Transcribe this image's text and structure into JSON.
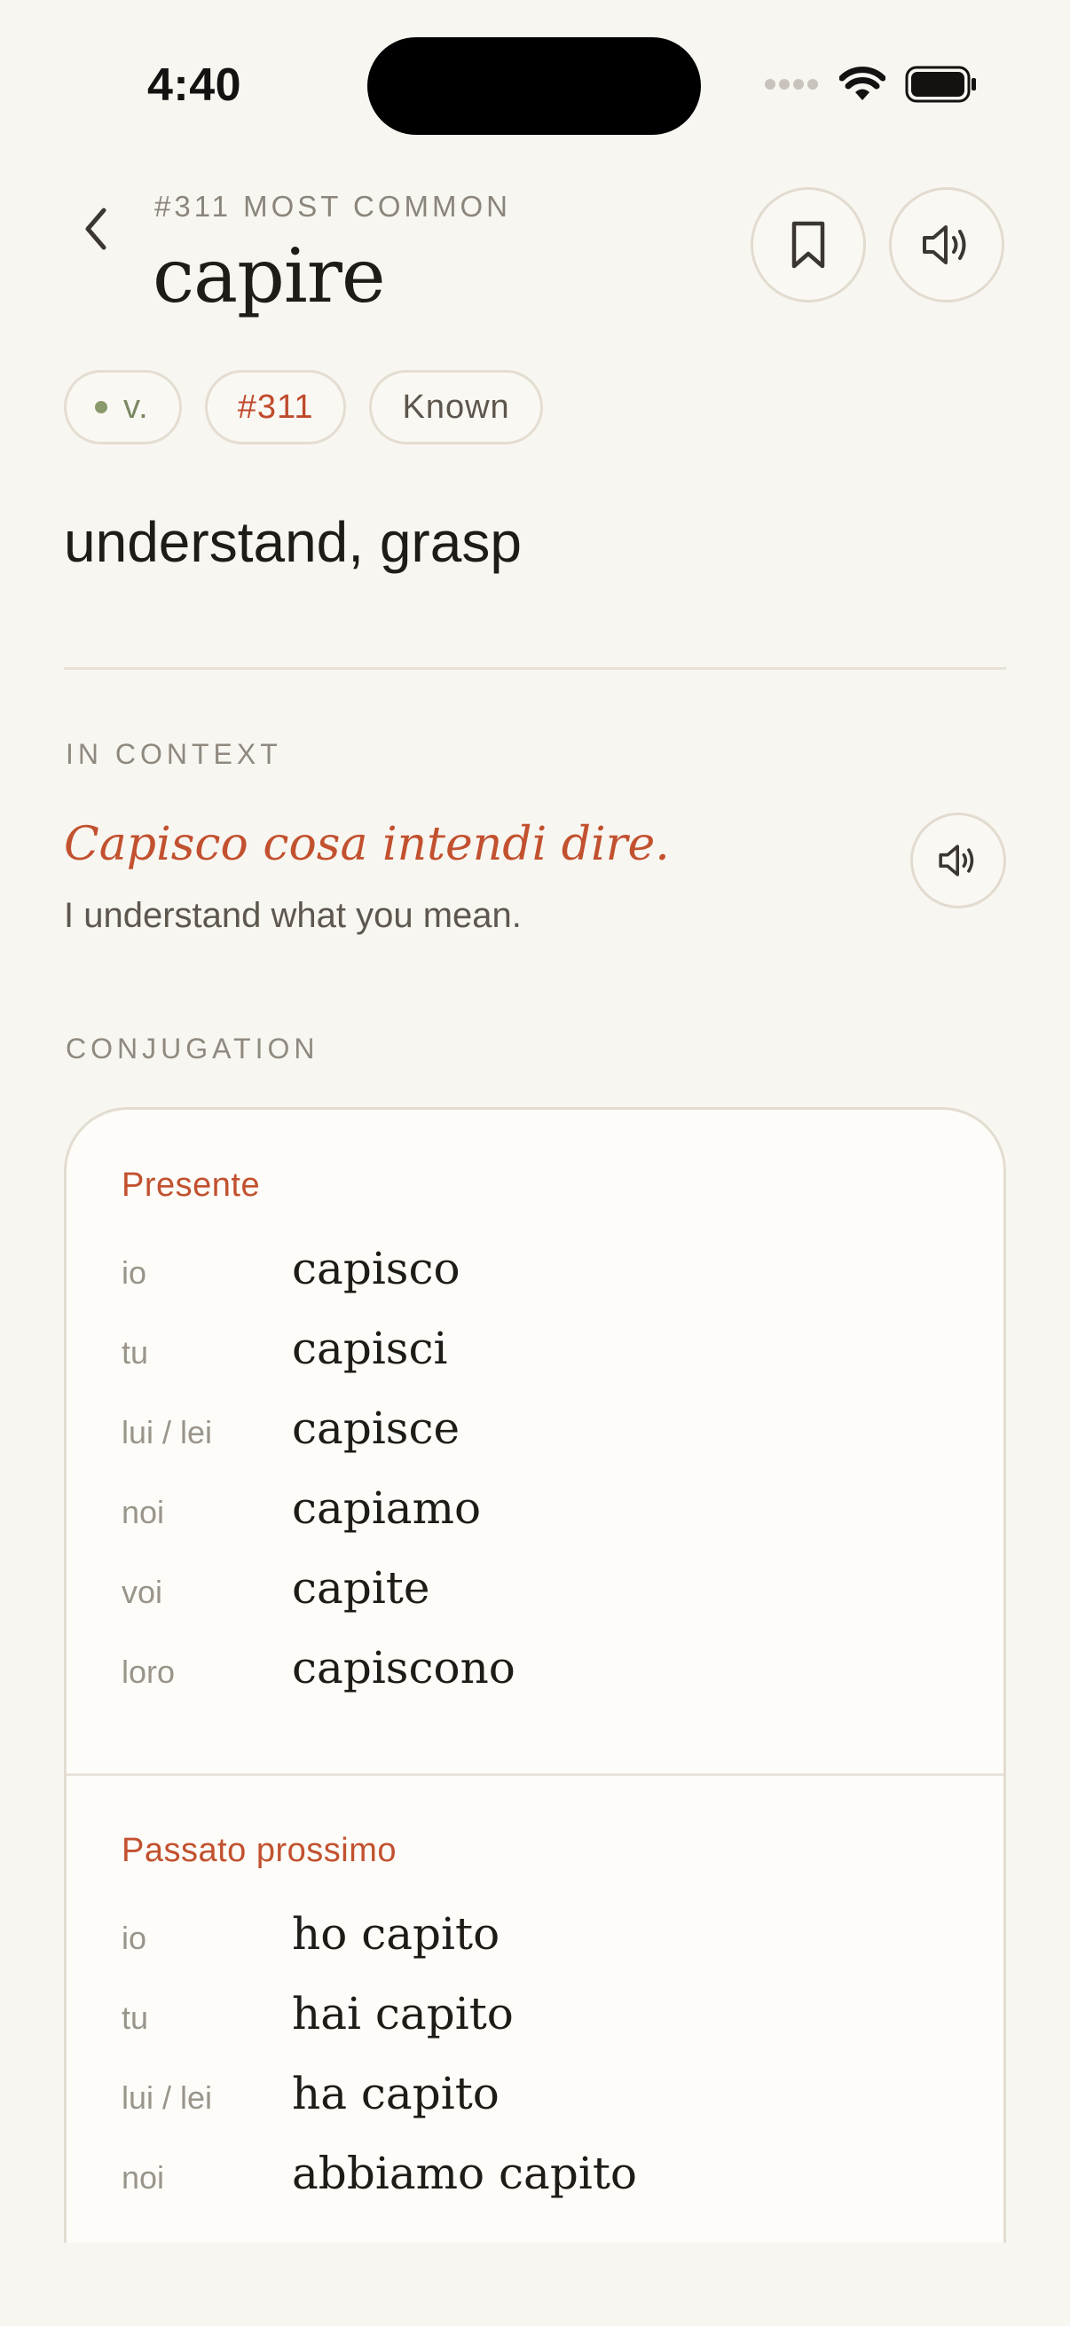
{
  "status": {
    "time": "4:40"
  },
  "header": {
    "eyebrow": "#311 MOST COMMON",
    "word": "capire"
  },
  "chips": {
    "pos": "v.",
    "rank": "#311",
    "status": "Known"
  },
  "definition": "understand, grasp",
  "context": {
    "label": "IN CONTEXT",
    "italian": "Capisco cosa intendi dire.",
    "english": "I understand what you mean."
  },
  "conjugation": {
    "label": "CONJUGATION",
    "tenses": [
      {
        "name": "Presente",
        "rows": [
          {
            "pronoun": "io",
            "form": "capisco"
          },
          {
            "pronoun": "tu",
            "form": "capisci"
          },
          {
            "pronoun": "lui / lei",
            "form": "capisce"
          },
          {
            "pronoun": "noi",
            "form": "capiamo"
          },
          {
            "pronoun": "voi",
            "form": "capite"
          },
          {
            "pronoun": "loro",
            "form": "capiscono"
          }
        ]
      },
      {
        "name": "Passato prossimo",
        "rows": [
          {
            "pronoun": "io",
            "form": "ho capito"
          },
          {
            "pronoun": "tu",
            "form": "hai capito"
          },
          {
            "pronoun": "lui / lei",
            "form": "ha capito"
          },
          {
            "pronoun": "noi",
            "form": "abbiamo capito"
          }
        ]
      }
    ]
  },
  "icons": {
    "back": "chevron-left-icon",
    "bookmark": "bookmark-icon",
    "sound": "speaker-icon"
  },
  "colors": {
    "accent": "#c2512f",
    "background": "#f8f6f1",
    "pos_dot": "#8a9a6c"
  }
}
